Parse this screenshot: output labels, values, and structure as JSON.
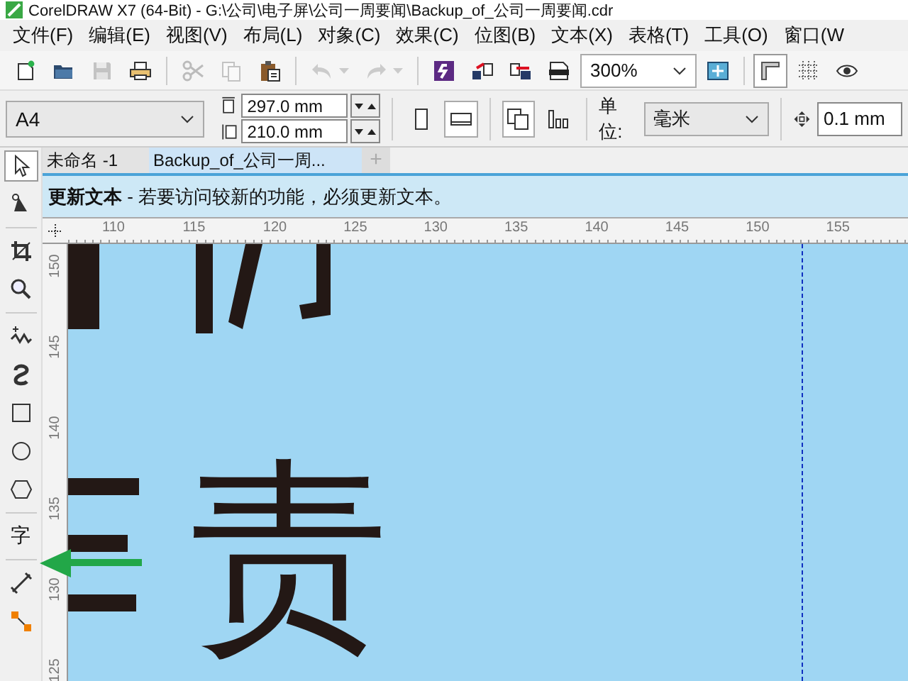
{
  "window": {
    "title": "CorelDRAW X7 (64-Bit) - G:\\公司\\电子屏\\公司一周要闻\\Backup_of_公司一周要闻.cdr"
  },
  "menu_bar": [
    {
      "label": "文件(F)"
    },
    {
      "label": "编辑(E)"
    },
    {
      "label": "视图(V)"
    },
    {
      "label": "布局(L)"
    },
    {
      "label": "对象(C)"
    },
    {
      "label": "效果(C)"
    },
    {
      "label": "位图(B)"
    },
    {
      "label": "文本(X)"
    },
    {
      "label": "表格(T)"
    },
    {
      "label": "工具(O)"
    },
    {
      "label": "窗口(W"
    }
  ],
  "toolbar": [
    {
      "kind": "button",
      "disabled": false,
      "on": false
    },
    {
      "kind": "button",
      "disabled": false,
      "on": false
    },
    {
      "kind": "button",
      "disabled": true,
      "on": false
    },
    {
      "kind": "button",
      "disabled": false,
      "on": false
    },
    {
      "kind": "separator"
    },
    {
      "kind": "button",
      "disabled": true,
      "on": false
    },
    {
      "kind": "button",
      "disabled": true,
      "on": false
    },
    {
      "kind": "button",
      "disabled": false,
      "on": false
    },
    {
      "kind": "separator"
    },
    {
      "kind": "split",
      "disabled": true,
      "on": false
    },
    {
      "kind": "split",
      "disabled": true,
      "on": false
    },
    {
      "kind": "separator"
    },
    {
      "kind": "button",
      "disabled": false,
      "on": false
    },
    {
      "kind": "button",
      "disabled": false,
      "on": false
    },
    {
      "kind": "button",
      "disabled": false,
      "on": false
    },
    {
      "kind": "button",
      "disabled": false,
      "on": false
    },
    {
      "kind": "combo",
      "value": "300%"
    },
    {
      "kind": "button",
      "disabled": false,
      "on": false
    },
    {
      "kind": "separator"
    },
    {
      "kind": "button",
      "disabled": false,
      "on": true
    },
    {
      "kind": "button",
      "disabled": false,
      "on": false
    },
    {
      "kind": "button",
      "disabled": false,
      "on": false
    }
  ],
  "property_bar": {
    "page_size": {
      "value": "A4"
    },
    "width": {
      "value": "297.0 mm"
    },
    "height": {
      "value": "210.0 mm"
    },
    "orientation": [
      {
        "selected": false
      },
      {
        "selected": true
      }
    ],
    "pages": [
      {
        "selected": true
      },
      {
        "selected": false
      }
    ],
    "units": {
      "label": "单位:",
      "value": "毫米"
    },
    "nudge": {
      "value": "0.1 mm"
    }
  },
  "toolbox": [
    {
      "kind": "icon",
      "selected": true
    },
    {
      "kind": "icon",
      "selected": false
    },
    {
      "kind": "icon",
      "selected": false
    },
    {
      "kind": "icon",
      "selected": false
    },
    {
      "kind": "icon",
      "selected": false
    },
    {
      "kind": "icon",
      "selected": false
    },
    {
      "kind": "icon",
      "selected": false
    },
    {
      "kind": "icon",
      "selected": false
    },
    {
      "kind": "icon",
      "selected": false
    },
    {
      "kind": "text",
      "label": "字",
      "selected": false
    },
    {
      "kind": "icon",
      "selected": false
    },
    {
      "kind": "icon",
      "selected": false
    }
  ],
  "document_tabs": [
    {
      "label": "未命名 -1",
      "selected": false
    },
    {
      "label": "Backup_of_公司一周...",
      "selected": true
    }
  ],
  "add_tab": "+",
  "info_bar": {
    "message": "**更新文本** - 若要访问较新的功能，必须更新文本。"
  },
  "horizontal_ruler": [
    "110",
    "115",
    "120",
    "125",
    "130",
    "135",
    "140",
    "145",
    "150",
    "155"
  ],
  "vertical_ruler": [
    "150",
    "145",
    "140",
    "135",
    "130",
    "125"
  ],
  "canvas": {
    "glyphs": [
      {
        "text": "责"
      }
    ]
  }
}
